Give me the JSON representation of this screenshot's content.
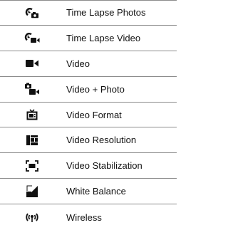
{
  "items": [
    {
      "icon": "time-lapse-photos-icon",
      "label": "Time Lapse Photos"
    },
    {
      "icon": "time-lapse-video-icon",
      "label": "Time Lapse Video"
    },
    {
      "icon": "video-camera-icon",
      "label": "Video"
    },
    {
      "icon": "video-photo-icon",
      "label": "Video + Photo"
    },
    {
      "icon": "video-format-icon",
      "label": "Video Format"
    },
    {
      "icon": "video-resolution-icon",
      "label": "Video Resolution"
    },
    {
      "icon": "video-stabilization-icon",
      "label": "Video Stabilization"
    },
    {
      "icon": "white-balance-icon",
      "label": "White Balance"
    },
    {
      "icon": "wireless-icon",
      "label": "Wireless"
    }
  ]
}
